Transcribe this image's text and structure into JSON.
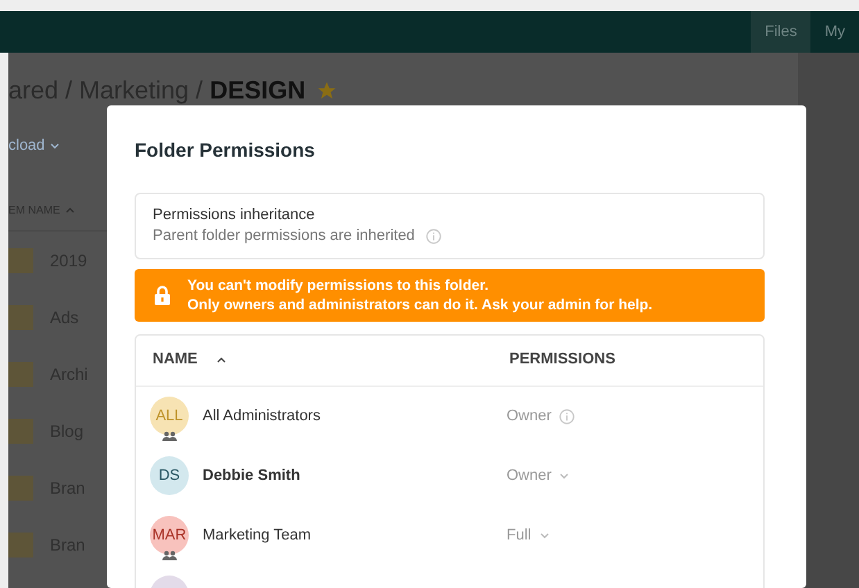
{
  "topbar": {
    "nav": [
      {
        "label": "Files",
        "selected": true
      },
      {
        "label": "My",
        "selected": false
      }
    ]
  },
  "breadcrumb": {
    "path": "ared / Marketing / ",
    "current": "DESIGN",
    "starred": true
  },
  "upload_button": {
    "label": "cload"
  },
  "file_list": {
    "column": "EM NAME",
    "rows": [
      {
        "name": "2019"
      },
      {
        "name": "Ads"
      },
      {
        "name": "Archi"
      },
      {
        "name": "Blog"
      },
      {
        "name": "Bran"
      },
      {
        "name": "Bran"
      }
    ]
  },
  "dialog": {
    "title": "Folder Permissions",
    "inheritance": {
      "title": "Permissions inheritance",
      "text": "Parent folder permissions are inherited"
    },
    "alert": {
      "line1": "You can't modify permissions to this folder.",
      "line2": "Only owners and administrators can do it. Ask your admin for help."
    },
    "table": {
      "columns": [
        "NAME",
        "PERMISSIONS"
      ],
      "rows": [
        {
          "initials": "ALL",
          "color": "#f7e3b3",
          "group": true,
          "name": "All Administrators",
          "bold": false,
          "permission": "Owner",
          "kind": "info"
        },
        {
          "initials": "DS",
          "color": "#d3e8ee",
          "group": false,
          "name": "Debbie Smith",
          "bold": true,
          "permission": "Owner",
          "kind": "dropdown"
        },
        {
          "initials": "MAR",
          "color": "#f8c2bd",
          "group": true,
          "name": "Marketing Team",
          "bold": false,
          "permission": "Full",
          "kind": "dropdown"
        },
        {
          "color": "#e3dbe9",
          "group": false,
          "kind": "none"
        }
      ]
    }
  }
}
